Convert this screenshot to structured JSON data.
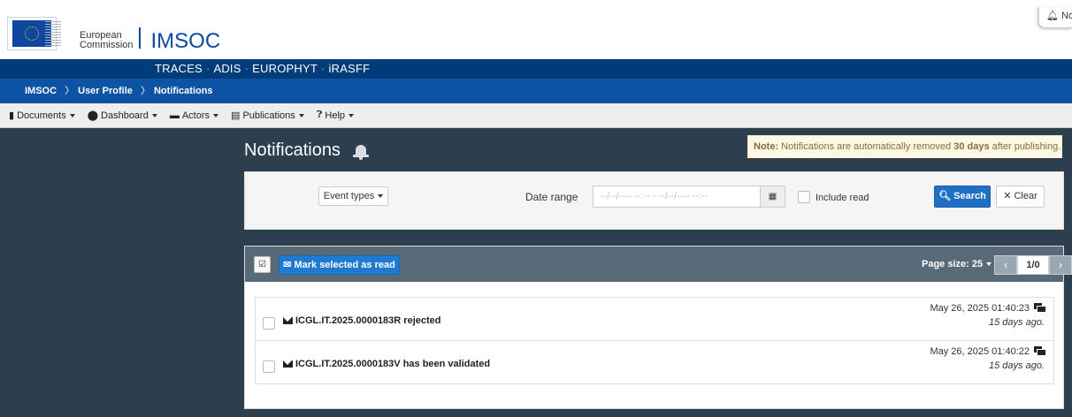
{
  "header": {
    "org_line1": "European",
    "org_line2": "Commission",
    "app_name": "IMSOC",
    "corner_label": "No"
  },
  "systems": [
    "TRACES",
    "ADIS",
    "EUROPHYT",
    "iRASFF"
  ],
  "systems_sep": "·",
  "breadcrumb": [
    "IMSOC",
    "User Profile",
    "Notifications"
  ],
  "menu": [
    {
      "label": "Documents",
      "icon": "file-icon"
    },
    {
      "label": "Dashboard",
      "icon": "globe-icon"
    },
    {
      "label": "Actors",
      "icon": "id-card-icon"
    },
    {
      "label": "Publications",
      "icon": "newspaper-icon"
    },
    {
      "label": "Help",
      "icon": "question-icon"
    }
  ],
  "page": {
    "title": "Notifications",
    "note_prefix": "Note:",
    "note_text1": " Notifications are automatically removed ",
    "note_bold": "30 days",
    "note_text2": " after publishing."
  },
  "filters": {
    "event_types_label": "Event types",
    "date_range_label": "Date range",
    "date_placeholder": "--/--/---- --:-- - --/--/---- --:--",
    "include_read_label": "Include read",
    "search_label": "Search",
    "clear_label": "Clear"
  },
  "list": {
    "mark_read_label": "Mark selected as read",
    "page_size_label": "Page size: 25",
    "page_indicator": "1/0",
    "items": [
      {
        "title": "ICGL.IT.2025.0000183R rejected",
        "date": "May 26, 2025 01:40:23",
        "ago": "15 days ago."
      },
      {
        "title": "ICGL.IT.2025.0000183V has been validated",
        "date": "May 26, 2025 01:40:22",
        "ago": "15 days ago."
      }
    ]
  },
  "colors": {
    "header_dark": "#003b7a",
    "breadcrumb_bar": "#0d53a3",
    "main_bg": "#2d3e4e",
    "primary_button": "#1f6fc4"
  }
}
